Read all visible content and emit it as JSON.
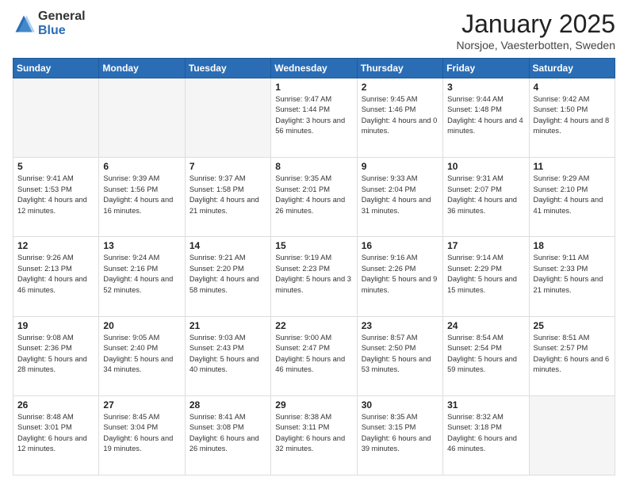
{
  "header": {
    "logo_general": "General",
    "logo_blue": "Blue",
    "month_title": "January 2025",
    "location": "Norsjoe, Vaesterbotten, Sweden"
  },
  "weekdays": [
    "Sunday",
    "Monday",
    "Tuesday",
    "Wednesday",
    "Thursday",
    "Friday",
    "Saturday"
  ],
  "weeks": [
    [
      {
        "day": "",
        "info": ""
      },
      {
        "day": "",
        "info": ""
      },
      {
        "day": "",
        "info": ""
      },
      {
        "day": "1",
        "info": "Sunrise: 9:47 AM\nSunset: 1:44 PM\nDaylight: 3 hours and 56 minutes."
      },
      {
        "day": "2",
        "info": "Sunrise: 9:45 AM\nSunset: 1:46 PM\nDaylight: 4 hours and 0 minutes."
      },
      {
        "day": "3",
        "info": "Sunrise: 9:44 AM\nSunset: 1:48 PM\nDaylight: 4 hours and 4 minutes."
      },
      {
        "day": "4",
        "info": "Sunrise: 9:42 AM\nSunset: 1:50 PM\nDaylight: 4 hours and 8 minutes."
      }
    ],
    [
      {
        "day": "5",
        "info": "Sunrise: 9:41 AM\nSunset: 1:53 PM\nDaylight: 4 hours and 12 minutes."
      },
      {
        "day": "6",
        "info": "Sunrise: 9:39 AM\nSunset: 1:56 PM\nDaylight: 4 hours and 16 minutes."
      },
      {
        "day": "7",
        "info": "Sunrise: 9:37 AM\nSunset: 1:58 PM\nDaylight: 4 hours and 21 minutes."
      },
      {
        "day": "8",
        "info": "Sunrise: 9:35 AM\nSunset: 2:01 PM\nDaylight: 4 hours and 26 minutes."
      },
      {
        "day": "9",
        "info": "Sunrise: 9:33 AM\nSunset: 2:04 PM\nDaylight: 4 hours and 31 minutes."
      },
      {
        "day": "10",
        "info": "Sunrise: 9:31 AM\nSunset: 2:07 PM\nDaylight: 4 hours and 36 minutes."
      },
      {
        "day": "11",
        "info": "Sunrise: 9:29 AM\nSunset: 2:10 PM\nDaylight: 4 hours and 41 minutes."
      }
    ],
    [
      {
        "day": "12",
        "info": "Sunrise: 9:26 AM\nSunset: 2:13 PM\nDaylight: 4 hours and 46 minutes."
      },
      {
        "day": "13",
        "info": "Sunrise: 9:24 AM\nSunset: 2:16 PM\nDaylight: 4 hours and 52 minutes."
      },
      {
        "day": "14",
        "info": "Sunrise: 9:21 AM\nSunset: 2:20 PM\nDaylight: 4 hours and 58 minutes."
      },
      {
        "day": "15",
        "info": "Sunrise: 9:19 AM\nSunset: 2:23 PM\nDaylight: 5 hours and 3 minutes."
      },
      {
        "day": "16",
        "info": "Sunrise: 9:16 AM\nSunset: 2:26 PM\nDaylight: 5 hours and 9 minutes."
      },
      {
        "day": "17",
        "info": "Sunrise: 9:14 AM\nSunset: 2:29 PM\nDaylight: 5 hours and 15 minutes."
      },
      {
        "day": "18",
        "info": "Sunrise: 9:11 AM\nSunset: 2:33 PM\nDaylight: 5 hours and 21 minutes."
      }
    ],
    [
      {
        "day": "19",
        "info": "Sunrise: 9:08 AM\nSunset: 2:36 PM\nDaylight: 5 hours and 28 minutes."
      },
      {
        "day": "20",
        "info": "Sunrise: 9:05 AM\nSunset: 2:40 PM\nDaylight: 5 hours and 34 minutes."
      },
      {
        "day": "21",
        "info": "Sunrise: 9:03 AM\nSunset: 2:43 PM\nDaylight: 5 hours and 40 minutes."
      },
      {
        "day": "22",
        "info": "Sunrise: 9:00 AM\nSunset: 2:47 PM\nDaylight: 5 hours and 46 minutes."
      },
      {
        "day": "23",
        "info": "Sunrise: 8:57 AM\nSunset: 2:50 PM\nDaylight: 5 hours and 53 minutes."
      },
      {
        "day": "24",
        "info": "Sunrise: 8:54 AM\nSunset: 2:54 PM\nDaylight: 5 hours and 59 minutes."
      },
      {
        "day": "25",
        "info": "Sunrise: 8:51 AM\nSunset: 2:57 PM\nDaylight: 6 hours and 6 minutes."
      }
    ],
    [
      {
        "day": "26",
        "info": "Sunrise: 8:48 AM\nSunset: 3:01 PM\nDaylight: 6 hours and 12 minutes."
      },
      {
        "day": "27",
        "info": "Sunrise: 8:45 AM\nSunset: 3:04 PM\nDaylight: 6 hours and 19 minutes."
      },
      {
        "day": "28",
        "info": "Sunrise: 8:41 AM\nSunset: 3:08 PM\nDaylight: 6 hours and 26 minutes."
      },
      {
        "day": "29",
        "info": "Sunrise: 8:38 AM\nSunset: 3:11 PM\nDaylight: 6 hours and 32 minutes."
      },
      {
        "day": "30",
        "info": "Sunrise: 8:35 AM\nSunset: 3:15 PM\nDaylight: 6 hours and 39 minutes."
      },
      {
        "day": "31",
        "info": "Sunrise: 8:32 AM\nSunset: 3:18 PM\nDaylight: 6 hours and 46 minutes."
      },
      {
        "day": "",
        "info": ""
      }
    ]
  ]
}
